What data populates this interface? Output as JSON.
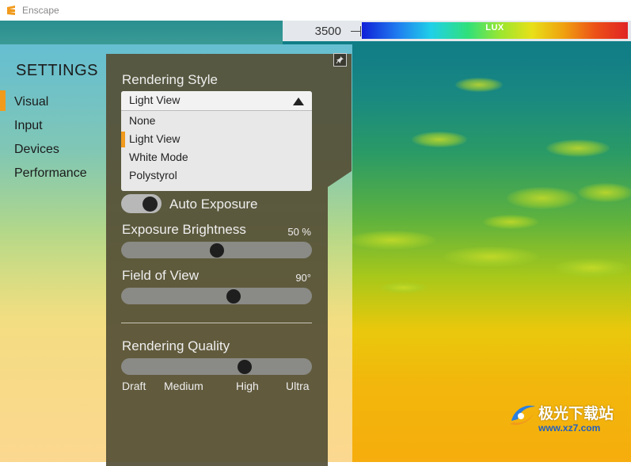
{
  "window": {
    "title": "Enscape",
    "logo_icon": "enscape-logo-icon"
  },
  "lux": {
    "value": "3500",
    "label": "LUX"
  },
  "sidebar": {
    "title": "SETTINGS",
    "items": [
      {
        "label": "Visual",
        "active": true
      },
      {
        "label": "Input",
        "active": false
      },
      {
        "label": "Devices",
        "active": false
      },
      {
        "label": "Performance",
        "active": false
      }
    ]
  },
  "panel": {
    "pin_icon": "pin-icon",
    "rendering_style": {
      "label": "Rendering Style",
      "selected": "Light View",
      "options": [
        "None",
        "Light View",
        "White Mode",
        "Polystyrol"
      ]
    },
    "auto_exposure": {
      "label": "Auto Exposure",
      "on": true
    },
    "exposure_brightness": {
      "label": "Exposure Brightness",
      "value": "50 %",
      "level": 0.5
    },
    "field_of_view": {
      "label": "Field of View",
      "value": "90°",
      "level": 0.6
    },
    "rendering_quality": {
      "label": "Rendering Quality",
      "levels": [
        "Draft",
        "Medium",
        "High",
        "Ultra"
      ],
      "selected": "High",
      "level": 0.66
    }
  },
  "watermark": {
    "text": "极光下载站",
    "url": "www.xz7.com"
  },
  "colors": {
    "accent": "#f19a1c",
    "panel": "#55503a"
  }
}
